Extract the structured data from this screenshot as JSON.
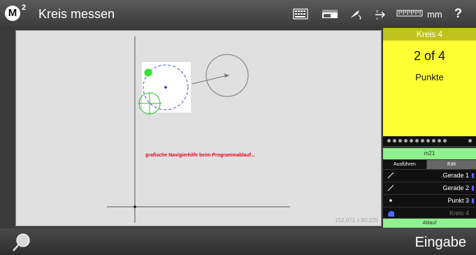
{
  "app": {
    "logo": "M",
    "logo_sup": "2",
    "title": "Kreis messen"
  },
  "toolbar": {
    "unit": "mm",
    "help": "?"
  },
  "canvas": {
    "hint": "grafische Navigierhilfe beim  Programmablauf...",
    "coords": "152,671 x 80,225"
  },
  "status": {
    "feature": "Kreis 4",
    "count": "2 of 4",
    "label": "Punkte"
  },
  "program": {
    "name": "m21",
    "tab_execute": "Ausführen",
    "tab_edit": "Edit",
    "run_label": "Ablauf"
  },
  "steps": [
    {
      "label": "Gerade 1",
      "icon": "line-icon"
    },
    {
      "label": "Gerade 2",
      "icon": "line-icon"
    },
    {
      "label": "Punkt 3",
      "icon": "point-icon"
    },
    {
      "label": "Kreis 4",
      "icon": "circle-icon"
    }
  ],
  "bottom": {
    "enter": "Eingabe"
  },
  "colors": {
    "status_bg": "#ffff33",
    "program_green": "#8ef08e",
    "hint_red": "#e8001c"
  }
}
